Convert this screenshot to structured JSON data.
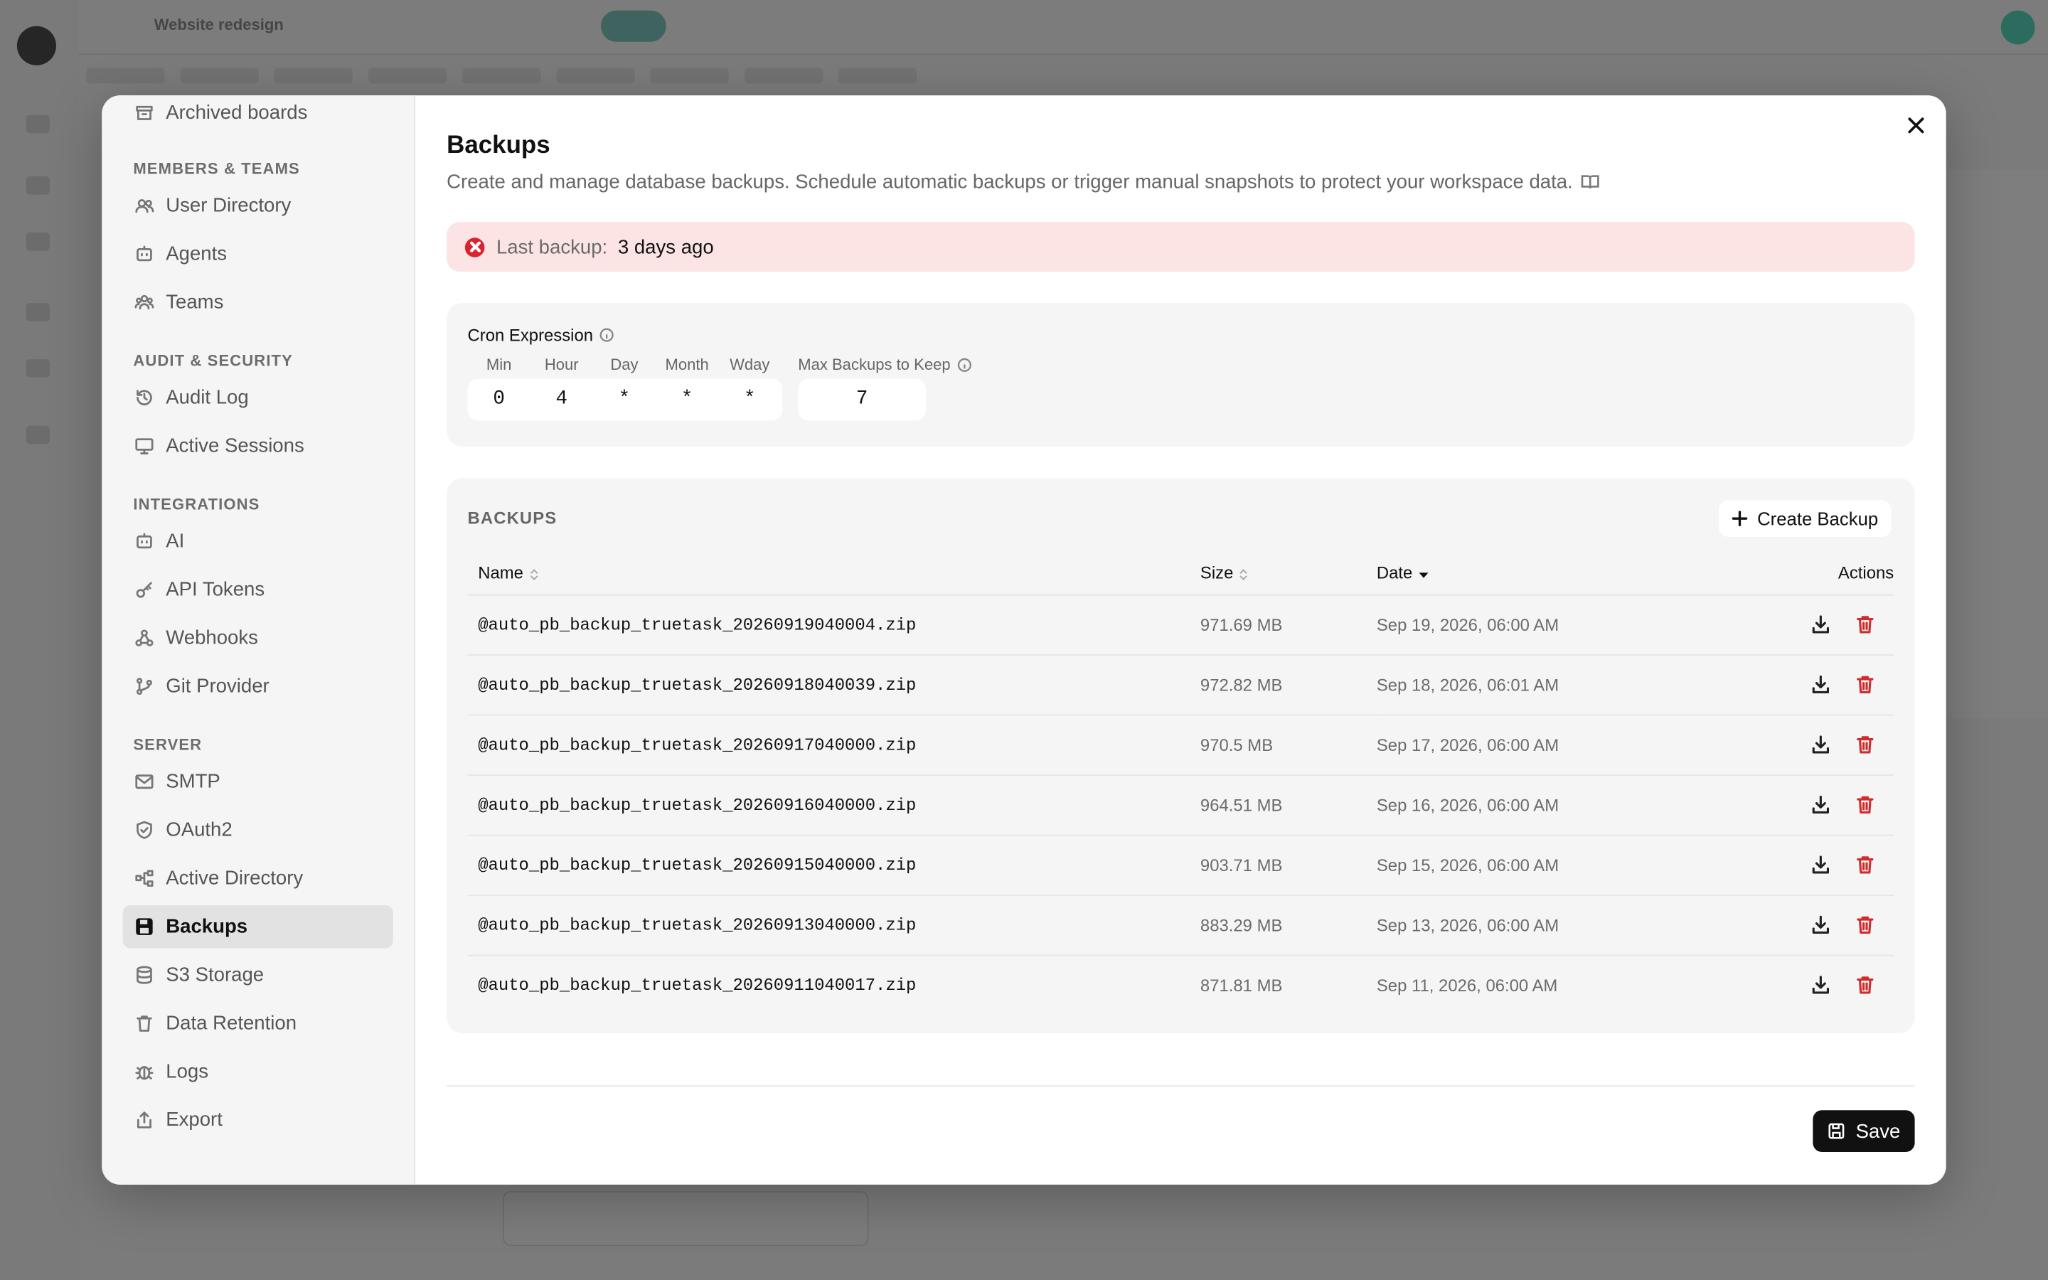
{
  "sidebar": {
    "top_item": "Archived boards",
    "sections": [
      {
        "title": "MEMBERS & TEAMS",
        "items": [
          "User Directory",
          "Agents",
          "Teams"
        ]
      },
      {
        "title": "AUDIT & SECURITY",
        "items": [
          "Audit Log",
          "Active Sessions"
        ]
      },
      {
        "title": "INTEGRATIONS",
        "items": [
          "AI",
          "API Tokens",
          "Webhooks",
          "Git Provider"
        ]
      },
      {
        "title": "SERVER",
        "items": [
          "SMTP",
          "OAuth2",
          "Active Directory",
          "Backups",
          "S3 Storage",
          "Data Retention",
          "Logs",
          "Export"
        ]
      }
    ],
    "active": "Backups"
  },
  "header": {
    "title": "Backups",
    "description": "Create and manage database backups. Schedule automatic backups or trigger manual snapshots to protect your workspace data."
  },
  "alert": {
    "label": "Last backup:",
    "value": "3 days ago"
  },
  "cron": {
    "title": "Cron Expression",
    "field_labels": [
      "Min",
      "Hour",
      "Day",
      "Month",
      "Wday"
    ],
    "field_values": [
      "0",
      "4",
      "*",
      "*",
      "*"
    ],
    "max_label": "Max Backups to Keep",
    "max_value": "7"
  },
  "backups": {
    "title": "BACKUPS",
    "create_label": "Create Backup",
    "columns": [
      "Name",
      "Size",
      "Date",
      "Actions"
    ],
    "rows": [
      {
        "name": "@auto_pb_backup_truetask_20260919040004.zip",
        "size": "971.69 MB",
        "date": "Sep 19, 2026, 06:00 AM"
      },
      {
        "name": "@auto_pb_backup_truetask_20260918040039.zip",
        "size": "972.82 MB",
        "date": "Sep 18, 2026, 06:01 AM"
      },
      {
        "name": "@auto_pb_backup_truetask_20260917040000.zip",
        "size": "970.5 MB",
        "date": "Sep 17, 2026, 06:00 AM"
      },
      {
        "name": "@auto_pb_backup_truetask_20260916040000.zip",
        "size": "964.51 MB",
        "date": "Sep 16, 2026, 06:00 AM"
      },
      {
        "name": "@auto_pb_backup_truetask_20260915040000.zip",
        "size": "903.71 MB",
        "date": "Sep 15, 2026, 06:00 AM"
      },
      {
        "name": "@auto_pb_backup_truetask_20260913040000.zip",
        "size": "883.29 MB",
        "date": "Sep 13, 2026, 06:00 AM"
      },
      {
        "name": "@auto_pb_backup_truetask_20260911040017.zip",
        "size": "871.81 MB",
        "date": "Sep 11, 2026, 06:00 AM"
      }
    ]
  },
  "footer": {
    "save_label": "Save"
  },
  "background": {
    "board_title": "Website redesign"
  },
  "colors": {
    "danger": "#d12b2b",
    "alert_bg": "#fce4e4",
    "primary": "#111111"
  }
}
